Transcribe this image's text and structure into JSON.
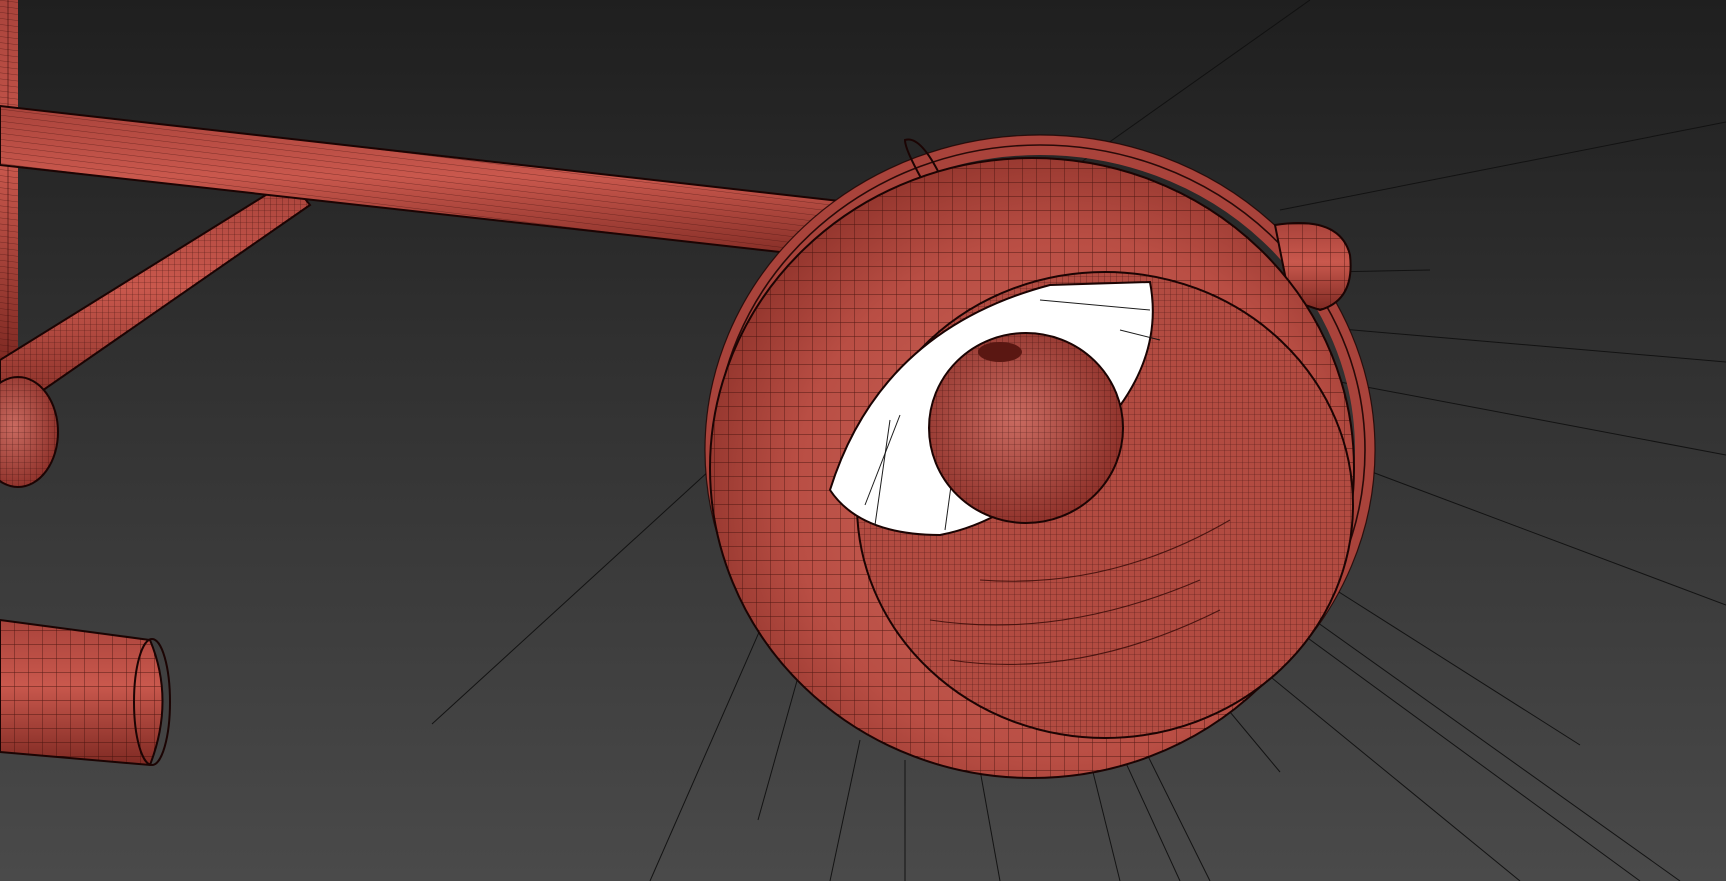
{
  "viewport": {
    "background_top": "#1f1f1f",
    "background_bottom": "#4a4a4a"
  },
  "model": {
    "mesh_color": "#c4544a",
    "mesh_shadow_color": "#8a2d26",
    "wire_color": "#3a0c08",
    "opening_color": "#ffffff",
    "ray_color": "#111111"
  }
}
